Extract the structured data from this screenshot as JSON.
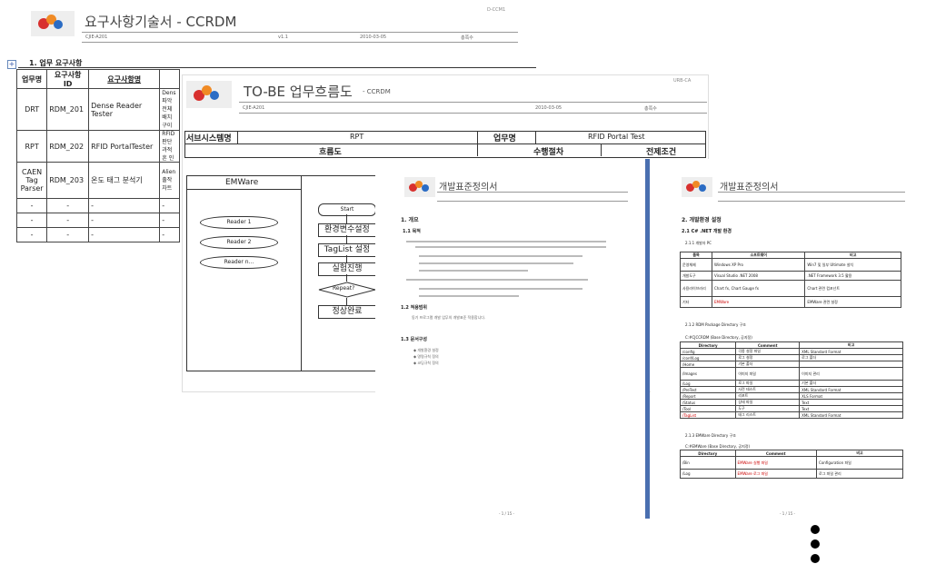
{
  "doc1": {
    "code": "D-CCM1",
    "title": "요구사항기술서 - CCRDM",
    "doc_id": "CJIE-A201",
    "version": "v1.1",
    "date": "2010-03-05",
    "page": "총쪽수",
    "section": "1. 업무 요구사항",
    "headers": [
      "업무명",
      "요구사항 ID",
      "요구사항명",
      ""
    ],
    "rows": [
      {
        "area": "DRT",
        "id": "RDM_201",
        "name": "Dense Reader Tester",
        "desc": "Dens 파악 전체 배치 구이"
      },
      {
        "area": "RPT",
        "id": "RDM_202",
        "name": "RFID PortalTester",
        "desc": "RFID 판단 과적 흔 인"
      },
      {
        "area": "CAEN Tag Parser",
        "id": "RDM_203",
        "name": "온도 태그 분석기",
        "desc": "Alien 출작 차트"
      },
      {
        "area": "-",
        "id": "-",
        "name": "-",
        "desc": "-"
      },
      {
        "area": "-",
        "id": "-",
        "name": "-",
        "desc": "-"
      },
      {
        "area": "-",
        "id": "-",
        "name": "-",
        "desc": "-"
      }
    ]
  },
  "doc2": {
    "code": "URB-CA",
    "title": "TO-BE 업무흐름도",
    "subtitle": "- CCRDM",
    "doc_id": "CJIE-A201",
    "date": "2010-03-05",
    "page": "총쪽수",
    "sys_label": "서브시스템명",
    "sys_value": "RPT",
    "biz_label": "업무명",
    "biz_value": "RFID Portal Test",
    "flow_label": "흐름도",
    "proc_label": "수행절차",
    "pre_label": "전제조건",
    "emware": "EMWare",
    "readers": [
      "Reader 1",
      "Reader 2",
      "Reader n..."
    ],
    "steps": [
      "Start",
      "환경변수설정",
      "TagList 설정",
      "실험진행",
      "Repeat?",
      "정상완료"
    ]
  },
  "doc3": {
    "title": "개발표준정의서",
    "sec1": "1. 개요",
    "sub1": "1.1 목적",
    "sub2": "1.2 적용범위",
    "sub2_text": "동기 프로그램 개발 업무의 개발표준 적용합니다.",
    "sub3": "1.3 문서구성",
    "bullets": [
      "개발환경 설정",
      "명명규칙 정의",
      "코딩규칙 정의"
    ],
    "footer": "- 1 / 15 -"
  },
  "doc4": {
    "title": "개발표준정의서",
    "sec": "2. 개발환경 설정",
    "sub": "2.1 C# .NET 개발 환경",
    "sub1": "2.1.1 개발자 PC",
    "table1_headers": [
      "품목",
      "소프트웨어",
      "비고"
    ],
    "table1_rows": [
      [
        "운영체제",
        "Windows XP Pro",
        "Win7 및 일부 Ultimate 설치"
      ],
      [
        "개발도구",
        "Visual Studio .NET 2008",
        ".NET Framework 3.5 활용"
      ],
      [
        "사용라이브러리",
        "Chart fx, Chart Gauge fx",
        "Chart 관련 컴포넌트"
      ],
      [
        "기타",
        "EMWare",
        "EMWare 관련 설정"
      ]
    ],
    "sub2": "2.1.2 RDM Package Directory 구조",
    "path1": "C:#CJCCRDM (Base Directory, 공지정)",
    "table2_headers": [
      "Directory",
      "Comment",
      "비고"
    ],
    "table2_rows": [
      [
        "/config",
        "각종 설정 파일",
        "XML Standard Format"
      ],
      [
        "/conf/Log",
        "로그 설정",
        "로그 폴더"
      ],
      [
        "/Home",
        "기본 폴더",
        ""
      ],
      [
        "/Images",
        "이미지 파일",
        "이미지 관리"
      ],
      [
        "/Log",
        "로그 파일",
        "기본 폴더"
      ],
      [
        "/PreTest",
        "사전 테스트",
        "XML Standard Format"
      ],
      [
        "/Report",
        "리포트",
        "XLS Format"
      ],
      [
        "/Status",
        "상태 파일",
        "Text"
      ],
      [
        "/Tool",
        "도구",
        "Text"
      ],
      [
        "/TagList",
        "태그 리스트",
        "XML Standard Format"
      ]
    ],
    "sub3": "2.1.3 EMWare Directory 구조",
    "path2": "C:#EMWare (Base Directory, 공지정)",
    "table3_headers": [
      "Directory",
      "Comment",
      "비고"
    ],
    "table3_rows": [
      [
        "/Bin",
        "EMWare 실행 파일",
        "Configuration 파일"
      ],
      [
        "/Log",
        "EMWare 로그 파일",
        "로그 파일 관리"
      ]
    ],
    "footer": "- 1 / 15 -"
  },
  "colors": {
    "accent_blue": "#3355aa",
    "logo_orange": "#f08a24",
    "logo_red": "#d8302e",
    "logo_blue": "#2b6cc4"
  }
}
